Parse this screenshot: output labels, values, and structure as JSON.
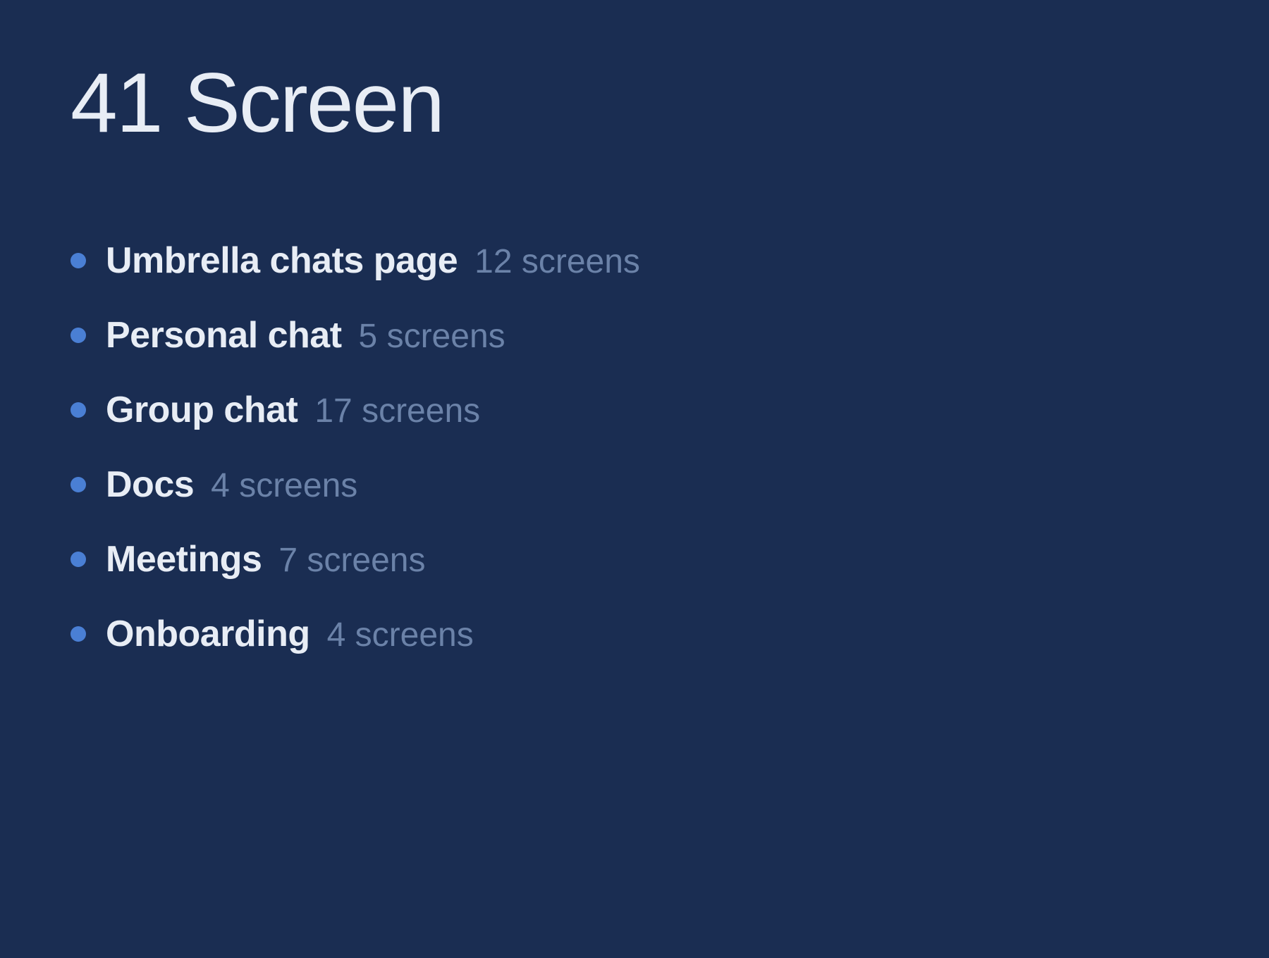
{
  "page": {
    "title": "41 Screen",
    "background_color": "#1a2d52"
  },
  "list": {
    "items": [
      {
        "id": "umbrella-chats",
        "label": "Umbrella chats page",
        "count": "12 screens"
      },
      {
        "id": "personal-chat",
        "label": "Personal chat",
        "count": "5 screens"
      },
      {
        "id": "group-chat",
        "label": "Group chat",
        "count": "17 screens"
      },
      {
        "id": "docs",
        "label": "Docs",
        "count": "4 screens"
      },
      {
        "id": "meetings",
        "label": "Meetings",
        "count": "7 screens"
      },
      {
        "id": "onboarding",
        "label": "Onboarding",
        "count": "4 screens"
      }
    ]
  }
}
